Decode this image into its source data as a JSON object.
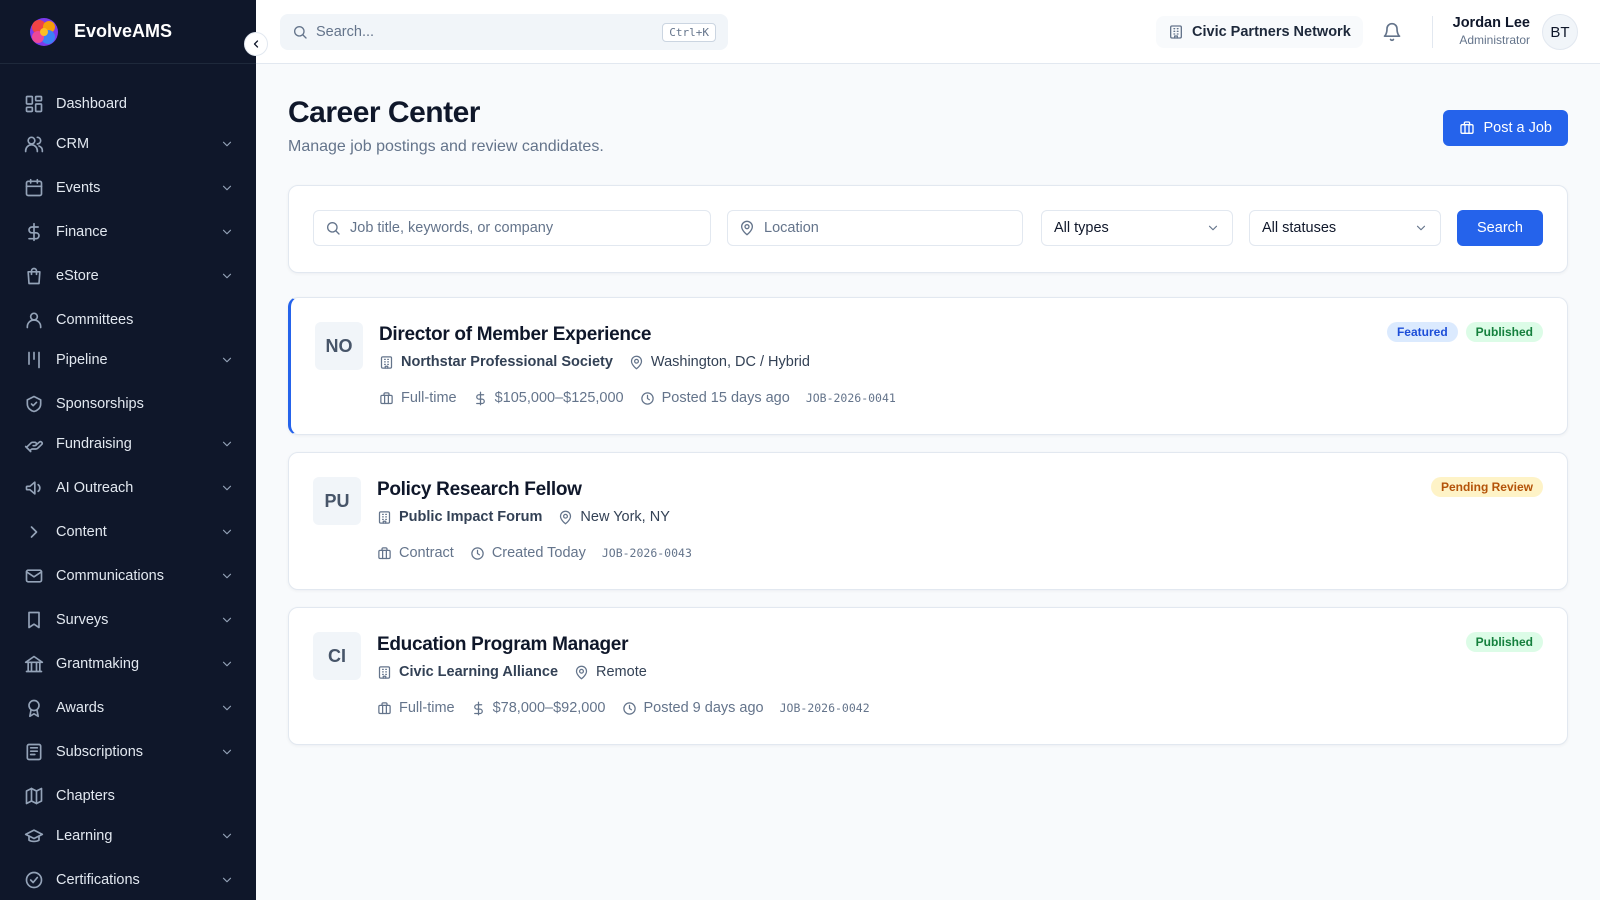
{
  "app": {
    "name": "EvolveAMS"
  },
  "sidebar": {
    "items": [
      {
        "label": "Dashboard",
        "icon": "dashboard-grid-icon",
        "expandable": false
      },
      {
        "label": "CRM",
        "icon": "users-icon",
        "expandable": true
      },
      {
        "label": "Events",
        "icon": "calendar-icon",
        "expandable": true
      },
      {
        "label": "Finance",
        "icon": "dollar-icon",
        "expandable": true
      },
      {
        "label": "eStore",
        "icon": "shopping-bag-icon",
        "expandable": true
      },
      {
        "label": "Committees",
        "icon": "user-group-icon",
        "expandable": false
      },
      {
        "label": "Pipeline",
        "icon": "kanban-icon",
        "expandable": true
      },
      {
        "label": "Sponsorships",
        "icon": "badge-icon",
        "expandable": false
      },
      {
        "label": "Fundraising",
        "icon": "hand-heart-icon",
        "expandable": true
      },
      {
        "label": "AI Outreach",
        "icon": "megaphone-icon",
        "expandable": true
      },
      {
        "label": "Content",
        "icon": "chevron-right-icon",
        "expandable": true
      },
      {
        "label": "Communications",
        "icon": "mail-icon",
        "expandable": true
      },
      {
        "label": "Surveys",
        "icon": "bookmark-icon",
        "expandable": true
      },
      {
        "label": "Grantmaking",
        "icon": "landmark-icon",
        "expandable": true
      },
      {
        "label": "Awards",
        "icon": "award-icon",
        "expandable": true
      },
      {
        "label": "Subscriptions",
        "icon": "newspaper-icon",
        "expandable": true
      },
      {
        "label": "Chapters",
        "icon": "map-icon",
        "expandable": false
      },
      {
        "label": "Learning",
        "icon": "graduation-cap-icon",
        "expandable": true
      },
      {
        "label": "Certifications",
        "icon": "check-circle-icon",
        "expandable": true
      }
    ]
  },
  "topbar": {
    "search_placeholder": "Search...",
    "search_shortcut": "Ctrl+K",
    "organization": "Civic Partners Network",
    "user_name": "Jordan Lee",
    "user_role": "Administrator",
    "avatar_initials": "BT"
  },
  "page": {
    "title": "Career Center",
    "subtitle": "Manage job postings and review candidates.",
    "post_button": "Post a Job"
  },
  "filters": {
    "keyword_placeholder": "Job title, keywords, or company",
    "location_placeholder": "Location",
    "type_value": "All types",
    "status_value": "All statuses",
    "search_button": "Search"
  },
  "jobs": [
    {
      "initials": "NO",
      "title": "Director of Member Experience",
      "organization": "Northstar Professional Society",
      "location": "Washington, DC / Hybrid",
      "type": "Full-time",
      "salary": "$105,000–$125,000",
      "posted": "Posted 15 days ago",
      "id": "JOB-2026-0041",
      "featured": true,
      "badges": [
        {
          "label": "Featured",
          "bg": "#dbeafe",
          "color": "#1d4ed8"
        },
        {
          "label": "Published",
          "bg": "#dcfce7",
          "color": "#15803d"
        }
      ]
    },
    {
      "initials": "PU",
      "title": "Policy Research Fellow",
      "organization": "Public Impact Forum",
      "location": "New York, NY",
      "type": "Contract",
      "salary": "",
      "posted": "Created Today",
      "id": "JOB-2026-0043",
      "featured": false,
      "badges": [
        {
          "label": "Pending Review",
          "bg": "#fef3c7",
          "color": "#b45309"
        }
      ]
    },
    {
      "initials": "CI",
      "title": "Education Program Manager",
      "organization": "Civic Learning Alliance",
      "location": "Remote",
      "type": "Full-time",
      "salary": "$78,000–$92,000",
      "posted": "Posted 9 days ago",
      "id": "JOB-2026-0042",
      "featured": false,
      "badges": [
        {
          "label": "Published",
          "bg": "#dcfce7",
          "color": "#15803d"
        }
      ]
    }
  ],
  "colors": {
    "sidebar_bg": "#0f172a",
    "accent": "#2563eb",
    "page_bg": "#f8fafc"
  }
}
